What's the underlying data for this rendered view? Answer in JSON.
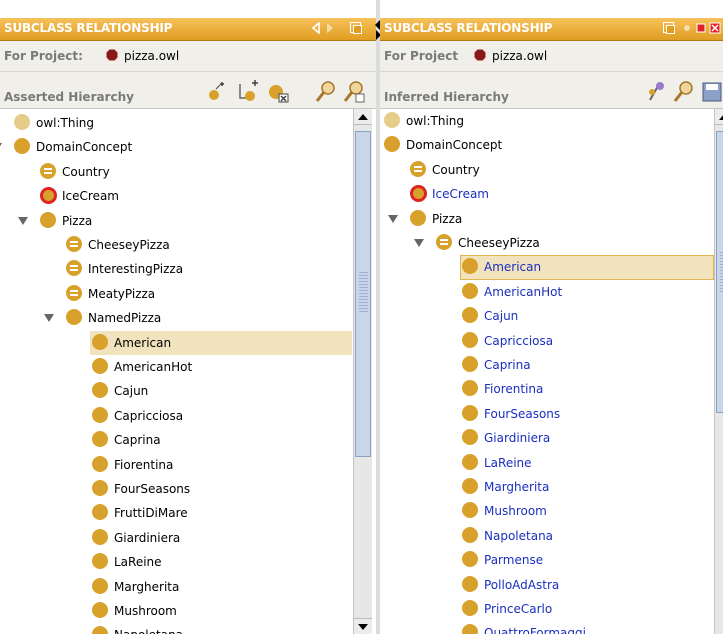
{
  "left": {
    "title": "SUBCLASS RELATIONSHIP",
    "project_label": "For Project:",
    "project_name": "pizza.owl",
    "hierarchy_label": "Asserted Hierarchy",
    "tree": [
      {
        "label": "owl:Thing",
        "depth": 0,
        "expand": "none",
        "icon": "pale",
        "selected": false
      },
      {
        "label": "DomainConcept",
        "depth": 0,
        "expand": "open",
        "icon": "class",
        "selected": false
      },
      {
        "label": "Country",
        "depth": 1,
        "expand": "none",
        "icon": "defined",
        "selected": false
      },
      {
        "label": "IceCream",
        "depth": 1,
        "expand": "none",
        "icon": "ring",
        "selected": false
      },
      {
        "label": "Pizza",
        "depth": 1,
        "expand": "open",
        "icon": "class",
        "selected": false
      },
      {
        "label": "CheeseyPizza",
        "depth": 2,
        "expand": "none",
        "icon": "defined",
        "selected": false
      },
      {
        "label": "InterestingPizza",
        "depth": 2,
        "expand": "none",
        "icon": "defined",
        "selected": false
      },
      {
        "label": "MeatyPizza",
        "depth": 2,
        "expand": "none",
        "icon": "defined",
        "selected": false
      },
      {
        "label": "NamedPizza",
        "depth": 2,
        "expand": "open",
        "icon": "class",
        "selected": false
      },
      {
        "label": "American",
        "depth": 3,
        "expand": "none",
        "icon": "class",
        "selected": true
      },
      {
        "label": "AmericanHot",
        "depth": 3,
        "expand": "none",
        "icon": "class",
        "selected": false
      },
      {
        "label": "Cajun",
        "depth": 3,
        "expand": "none",
        "icon": "class",
        "selected": false
      },
      {
        "label": "Capricciosa",
        "depth": 3,
        "expand": "none",
        "icon": "class",
        "selected": false
      },
      {
        "label": "Caprina",
        "depth": 3,
        "expand": "none",
        "icon": "class",
        "selected": false
      },
      {
        "label": "Fiorentina",
        "depth": 3,
        "expand": "none",
        "icon": "class",
        "selected": false
      },
      {
        "label": "FourSeasons",
        "depth": 3,
        "expand": "none",
        "icon": "class",
        "selected": false
      },
      {
        "label": "FruttiDiMare",
        "depth": 3,
        "expand": "none",
        "icon": "class",
        "selected": false
      },
      {
        "label": "Giardiniera",
        "depth": 3,
        "expand": "none",
        "icon": "class",
        "selected": false
      },
      {
        "label": "LaReine",
        "depth": 3,
        "expand": "none",
        "icon": "class",
        "selected": false
      },
      {
        "label": "Margherita",
        "depth": 3,
        "expand": "none",
        "icon": "class",
        "selected": false
      },
      {
        "label": "Mushroom",
        "depth": 3,
        "expand": "none",
        "icon": "class",
        "selected": false
      },
      {
        "label": "Napoletana",
        "depth": 3,
        "expand": "none",
        "icon": "class",
        "selected": false
      }
    ]
  },
  "right": {
    "title": "SUBCLASS RELATIONSHIP",
    "project_label": "For Project",
    "project_name": "pizza.owl",
    "hierarchy_label": "Inferred Hierarchy",
    "tree": [
      {
        "label": "owl:Thing",
        "depth": 0,
        "expand": "none",
        "icon": "pale",
        "selected": false,
        "blue": false
      },
      {
        "label": "DomainConcept",
        "depth": 0,
        "expand": "open",
        "icon": "class",
        "selected": false,
        "blue": false
      },
      {
        "label": "Country",
        "depth": 1,
        "expand": "none",
        "icon": "defined",
        "selected": false,
        "blue": false
      },
      {
        "label": "IceCream",
        "depth": 1,
        "expand": "none",
        "icon": "ring",
        "selected": false,
        "blue": true
      },
      {
        "label": "Pizza",
        "depth": 1,
        "expand": "open",
        "icon": "class",
        "selected": false,
        "blue": false
      },
      {
        "label": "CheeseyPizza",
        "depth": 2,
        "expand": "open",
        "icon": "defined",
        "selected": false,
        "blue": false
      },
      {
        "label": "American",
        "depth": 3,
        "expand": "none",
        "icon": "class",
        "selected": true,
        "blue": true
      },
      {
        "label": "AmericanHot",
        "depth": 3,
        "expand": "none",
        "icon": "class",
        "selected": false,
        "blue": true
      },
      {
        "label": "Cajun",
        "depth": 3,
        "expand": "none",
        "icon": "class",
        "selected": false,
        "blue": true
      },
      {
        "label": "Capricciosa",
        "depth": 3,
        "expand": "none",
        "icon": "class",
        "selected": false,
        "blue": true
      },
      {
        "label": "Caprina",
        "depth": 3,
        "expand": "none",
        "icon": "class",
        "selected": false,
        "blue": true
      },
      {
        "label": "Fiorentina",
        "depth": 3,
        "expand": "none",
        "icon": "class",
        "selected": false,
        "blue": true
      },
      {
        "label": "FourSeasons",
        "depth": 3,
        "expand": "none",
        "icon": "class",
        "selected": false,
        "blue": true
      },
      {
        "label": "Giardiniera",
        "depth": 3,
        "expand": "none",
        "icon": "class",
        "selected": false,
        "blue": true
      },
      {
        "label": "LaReine",
        "depth": 3,
        "expand": "none",
        "icon": "class",
        "selected": false,
        "blue": true
      },
      {
        "label": "Margherita",
        "depth": 3,
        "expand": "none",
        "icon": "class",
        "selected": false,
        "blue": true
      },
      {
        "label": "Mushroom",
        "depth": 3,
        "expand": "none",
        "icon": "class",
        "selected": false,
        "blue": true
      },
      {
        "label": "Napoletana",
        "depth": 3,
        "expand": "none",
        "icon": "class",
        "selected": false,
        "blue": true
      },
      {
        "label": "Parmense",
        "depth": 3,
        "expand": "none",
        "icon": "class",
        "selected": false,
        "blue": true
      },
      {
        "label": "PolloAdAstra",
        "depth": 3,
        "expand": "none",
        "icon": "class",
        "selected": false,
        "blue": true
      },
      {
        "label": "PrinceCarlo",
        "depth": 3,
        "expand": "none",
        "icon": "class",
        "selected": false,
        "blue": true
      },
      {
        "label": "QuattroFormaggi",
        "depth": 3,
        "expand": "none",
        "icon": "class",
        "selected": false,
        "blue": true
      }
    ]
  },
  "colors": {
    "title_bar": "#e9a93a",
    "class_icon": "#d8a12c",
    "selection": "#f2e3bf",
    "inferred_text": "#1a2fbf",
    "project_icon": "#8b1a1a"
  }
}
